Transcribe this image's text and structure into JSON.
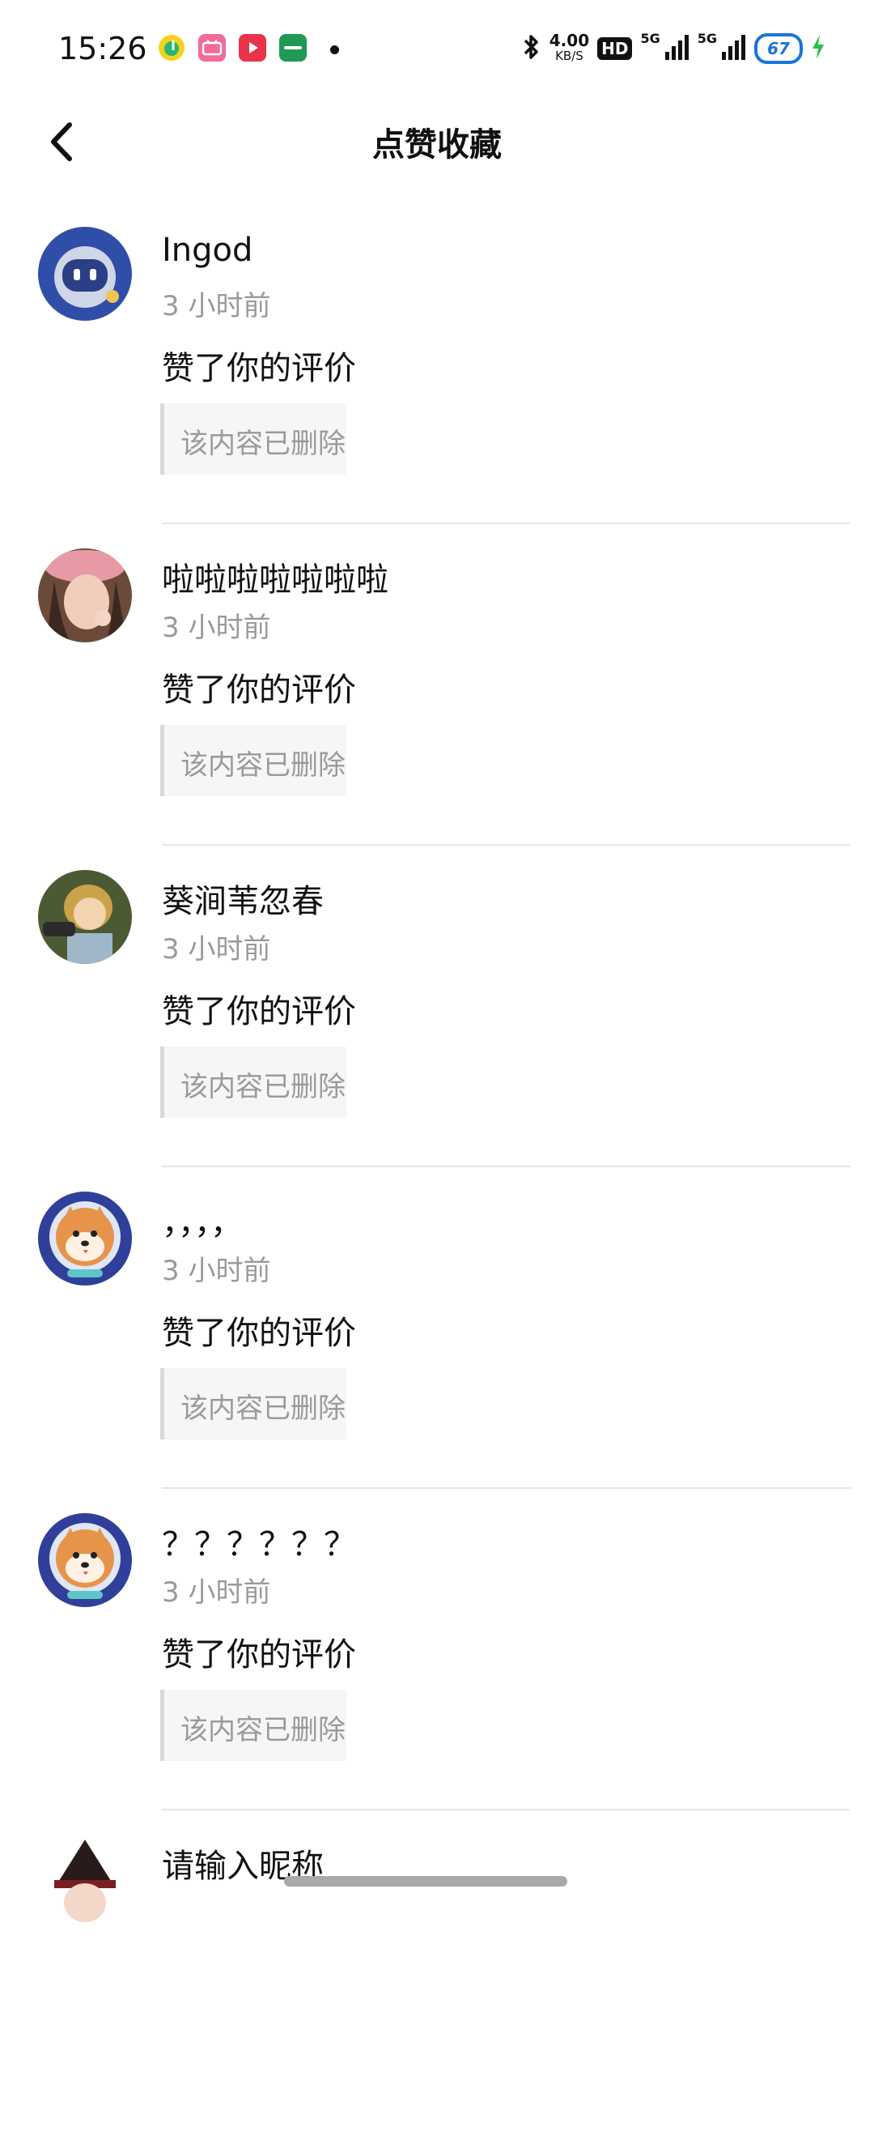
{
  "status_bar": {
    "time": "15:26",
    "net_speed_value": "4.00",
    "net_speed_unit": "KB/S",
    "hd_label": "HD",
    "network_1": "5G",
    "network_2": "5G",
    "battery": "67",
    "app_icons": [
      "qq-music-icon",
      "bilibili-icon",
      "video-player-icon",
      "oppo-app-icon"
    ],
    "colors": {
      "battery_blue": "#1d74d8",
      "charging_green": "#2bbf4a"
    }
  },
  "header": {
    "title": "点赞收藏",
    "back_icon": "chevron-left-icon"
  },
  "notifications": [
    {
      "nickname": "Ingod",
      "time": "3 小时前",
      "action": "赞了你的评价",
      "quote": "该内容已删除",
      "avatar": "robot-avatar"
    },
    {
      "nickname": "啦啦啦啦啦啦啦",
      "time": "3 小时前",
      "action": "赞了你的评价",
      "quote": "该内容已删除",
      "avatar": "girl-pink-hat-avatar"
    },
    {
      "nickname": "葵涧苇忽春",
      "time": "3 小时前",
      "action": "赞了你的评价",
      "quote": "该内容已删除",
      "avatar": "anime-girl-avatar"
    },
    {
      "nickname": "，，，，",
      "time": "3 小时前",
      "action": "赞了你的评价",
      "quote": "该内容已删除",
      "avatar": "shiba-astronaut-avatar"
    },
    {
      "nickname": "？？？？？？",
      "time": "3 小时前",
      "action": "赞了你的评价",
      "quote": "该内容已删除",
      "avatar": "shiba-astronaut-avatar"
    },
    {
      "nickname": "请输入昵称",
      "time": "",
      "action": "",
      "quote": "",
      "avatar": "witch-hat-avatar"
    }
  ]
}
